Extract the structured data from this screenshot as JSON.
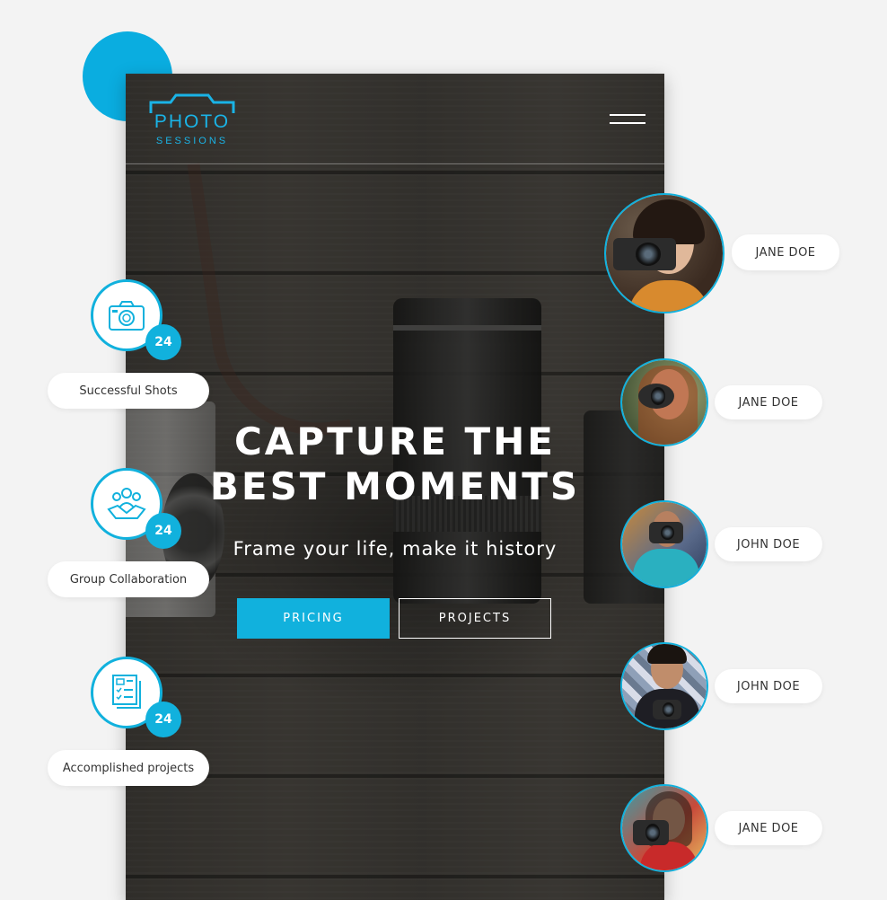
{
  "brand": {
    "logo_word": "PHOTO",
    "logo_sub": "SESSIONS",
    "accent_color": "#11b1dd"
  },
  "header": {
    "menu_icon": "hamburger-menu-icon"
  },
  "hero": {
    "title_line1": "CAPTURE THE",
    "title_line2": "BEST MOMENTS",
    "subtitle": "Frame your life, make it history",
    "primary_button": "PRICING",
    "secondary_button": "PROJECTS"
  },
  "stats": [
    {
      "icon": "camera-icon",
      "count": "24",
      "label": "Successful Shots"
    },
    {
      "icon": "team-handshake-icon",
      "count": "24",
      "label": "Group Collaboration"
    },
    {
      "icon": "documents-checklist-icon",
      "count": "24",
      "label": "Accomplished projects"
    }
  ],
  "people": [
    {
      "name": "JANE DOE"
    },
    {
      "name": "JANE DOE"
    },
    {
      "name": "JOHN DOE"
    },
    {
      "name": "JOHN DOE"
    },
    {
      "name": "JANE DOE"
    }
  ]
}
